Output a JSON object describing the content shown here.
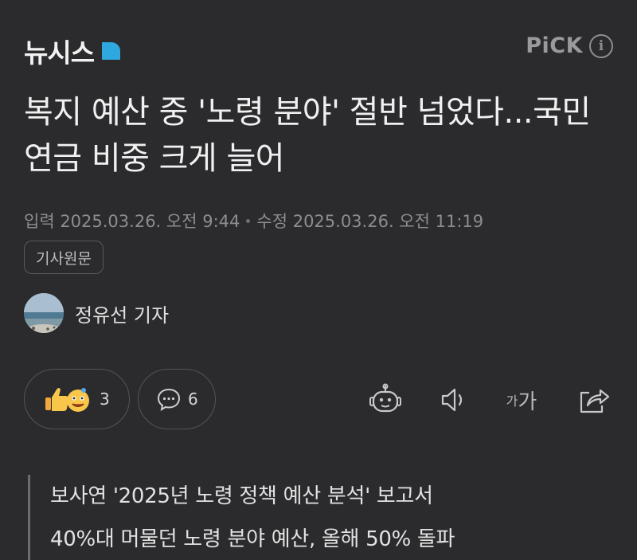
{
  "header": {
    "logo_text": "뉴시스",
    "pick_label": "PiCK",
    "brand_color": "#2fa8e0"
  },
  "article": {
    "headline": "복지 예산 중 '노령 분야' 절반 넘었다...국민연금 비중 크게 늘어",
    "published": "입력 2025.03.26. 오전 9:44",
    "modified": "수정 2025.03.26. 오전 11:19",
    "origin_button": "기사원문",
    "reporter": "정유선 기자"
  },
  "actions": {
    "reaction_count": "3",
    "comment_count": "6",
    "font_size_label_small": "가",
    "font_size_label_large": "가"
  },
  "summary": {
    "lines": [
      "보사연 '2025년 노령 정책 예산 분석' 보고서",
      "40%대 머물던 노령 분야 예산, 올해 50% 돌파"
    ]
  }
}
